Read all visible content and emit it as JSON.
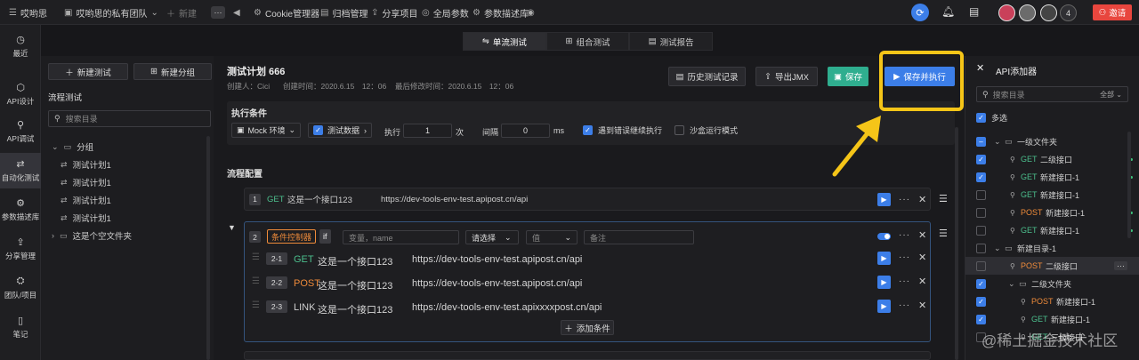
{
  "topbar": {
    "brand": "哎哟思",
    "team": "哎哟思的私有团队",
    "new": "新建",
    "more": "···",
    "links": [
      "Cookie管理器",
      "归档管理",
      "分享项目",
      "全局参数",
      "参数描述库"
    ],
    "avatar_count": "4",
    "invite": "邀请"
  },
  "nav": [
    {
      "label": "最近",
      "icon": "clock-icon"
    },
    {
      "label": "API设计",
      "icon": "design-icon"
    },
    {
      "label": "API调试",
      "icon": "debug-icon"
    },
    {
      "label": "自动化测试",
      "icon": "automation-icon"
    },
    {
      "label": "参数描述库",
      "icon": "params-icon"
    },
    {
      "label": "分享管理",
      "icon": "share-icon"
    },
    {
      "label": "团队/项目",
      "icon": "team-icon"
    },
    {
      "label": "笔记",
      "icon": "note-icon"
    }
  ],
  "tree": {
    "new_test": "新建测试",
    "new_group": "新建分组",
    "title": "流程测试",
    "search_placeholder": "搜索目录",
    "items": [
      {
        "label": "分组",
        "type": "folder"
      },
      {
        "label": "测试计划1",
        "type": "plan"
      },
      {
        "label": "测试计划1",
        "type": "plan"
      },
      {
        "label": "测试计划1",
        "type": "plan"
      },
      {
        "label": "测试计划1",
        "type": "plan"
      },
      {
        "label": "这是个空文件夹",
        "type": "folder"
      }
    ]
  },
  "tabs": [
    "单流测试",
    "组合测试",
    "测试报告"
  ],
  "plan": {
    "title": "测试计划 666",
    "creator": "创建人：Cici",
    "created": "创建时间：2020.6.15　12：06",
    "modified": "最后修改时间：2020.6.15　12：06",
    "history_btn": "历史测试记录",
    "export_btn": "导出JMX",
    "save_btn": "保存",
    "save_run_btn": "保存并执行"
  },
  "exec": {
    "title": "执行条件",
    "mock": "Mock 环境",
    "test_data": "测试数据",
    "exec_label": "执行",
    "exec_value": "1",
    "times": "次",
    "interval_label": "间隔",
    "interval_value": "0",
    "ms": "ms",
    "continue_on_error": "遇到错误继续执行",
    "sandbox": "沙盒运行模式"
  },
  "flow": {
    "title": "流程配置",
    "rows": [
      {
        "num": "1",
        "method": "GET",
        "name": "这是一个接口123",
        "url": "https://dev-tools-env-test.apipost.cn/api"
      }
    ],
    "cond": {
      "num": "2",
      "tag": "条件控制器",
      "if": "if",
      "var_placeholder": "变量，name",
      "select": "请选择",
      "value_placeholder": "值",
      "note_placeholder": "备注",
      "children": [
        {
          "num": "2-1",
          "method": "GET",
          "name": "这是一个接口123",
          "url": "https://dev-tools-env-test.apipost.cn/api"
        },
        {
          "num": "2-2",
          "method": "POST",
          "name": "这是一个接口123",
          "url": "https://dev-tools-env-test.apipost.cn/api"
        },
        {
          "num": "2-3",
          "method": "LINK",
          "name": "这是一个接口123",
          "url": "https://dev-tools-env-test.apixxxxpost.cn/api"
        }
      ],
      "add_cond": "添加条件"
    }
  },
  "api_adder": {
    "title": "API添加器",
    "search_placeholder": "搜索目录",
    "scope": "全部",
    "multi": "多选",
    "rows": [
      {
        "label": "一级文件夹",
        "type": "folder",
        "checked": "partial",
        "indent": 0
      },
      {
        "method": "GET",
        "label": "二级接口",
        "checked": true,
        "indent": 1,
        "dot": true
      },
      {
        "method": "GET",
        "label": "新建接口-1",
        "checked": true,
        "indent": 1,
        "dot": true
      },
      {
        "method": "GET",
        "label": "新建接口-1",
        "checked": false,
        "indent": 1,
        "dot": false
      },
      {
        "method": "POST",
        "label": "新建接口-1",
        "checked": false,
        "indent": 1,
        "dot": true
      },
      {
        "method": "GET",
        "label": "新建接口-1",
        "checked": false,
        "indent": 1,
        "dot": true
      },
      {
        "label": "新建目录-1",
        "type": "folder",
        "checked": false,
        "indent": 0
      },
      {
        "method": "POST",
        "label": "二级接口",
        "checked": false,
        "indent": 1,
        "dot": false,
        "hover": true
      },
      {
        "label": "二级文件夹",
        "type": "folder",
        "checked": true,
        "indent": 2
      },
      {
        "method": "POST",
        "label": "新建接口-1",
        "checked": true,
        "indent": 3
      },
      {
        "method": "GET",
        "label": "新建接口-1",
        "checked": true,
        "indent": 3
      },
      {
        "method": "GET",
        "label": "三级接口",
        "checked": false,
        "indent": 3
      }
    ]
  },
  "watermark": "@稀土掘金技术社区"
}
